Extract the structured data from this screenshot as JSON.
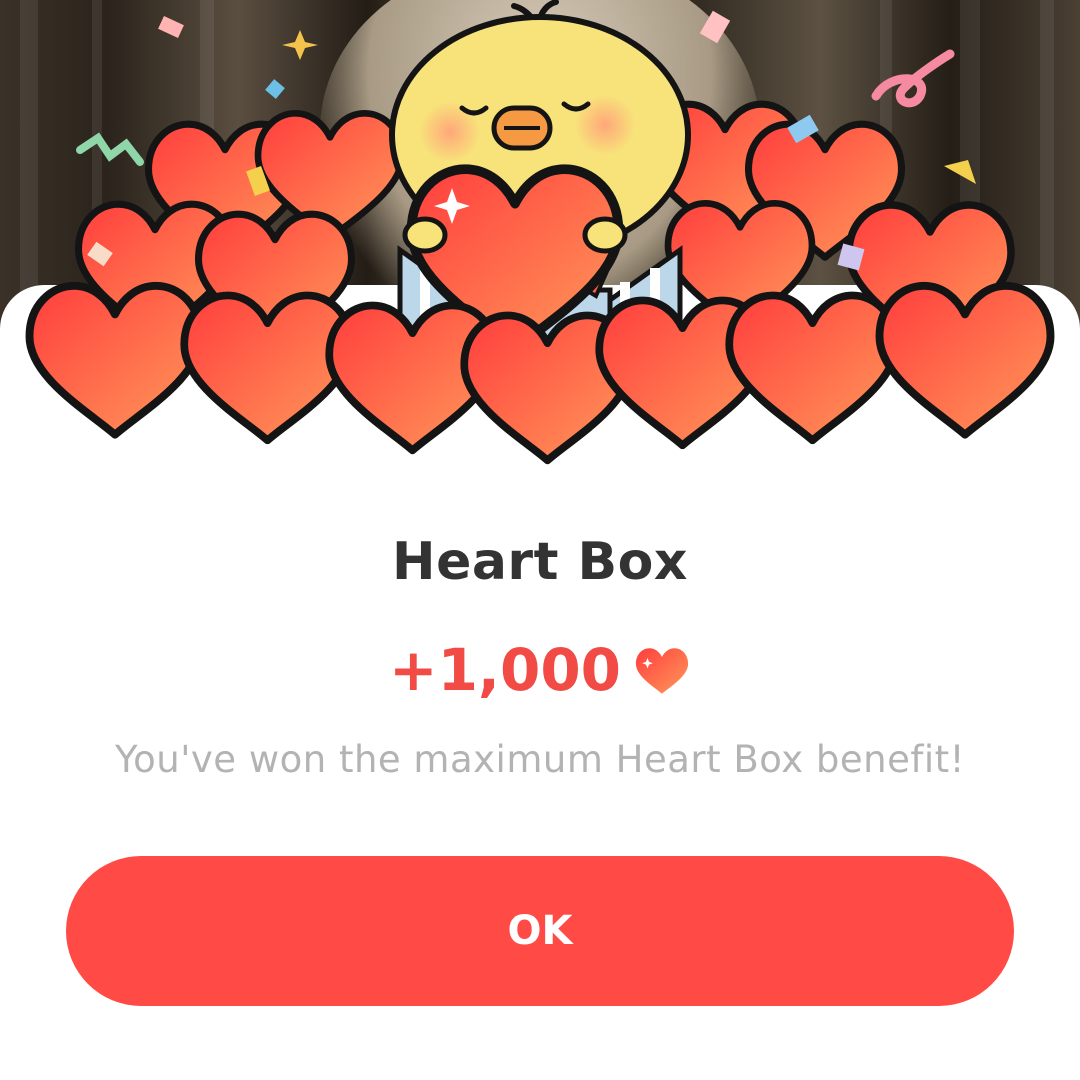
{
  "dialog": {
    "title": "Heart Box",
    "reward_amount": "+1,000",
    "reward_icon": "heart-icon",
    "message": "You've won the maximum Heart Box benefit!",
    "ok_label": "OK"
  },
  "colors": {
    "accent": "#ff4a46",
    "reward_text": "#f24a44",
    "title_text": "#333333",
    "message_text": "#b3b3b3",
    "heart_fill_light": "#ff9a5a",
    "heart_fill_dark": "#ff3d3d",
    "chick_yellow": "#f8e27a"
  },
  "illustration": {
    "character": "yellow-chick",
    "props": [
      "heart-pile",
      "gift-box",
      "confetti"
    ]
  }
}
